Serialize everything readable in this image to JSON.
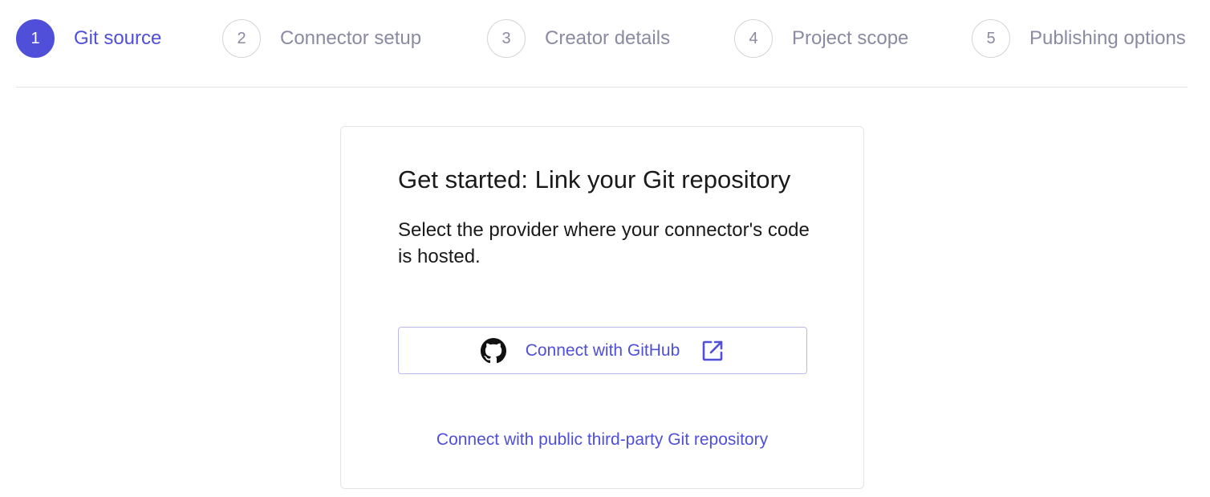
{
  "stepper": {
    "steps": [
      {
        "number": "1",
        "label": "Git source",
        "state": "active"
      },
      {
        "number": "2",
        "label": "Connector setup",
        "state": "inactive"
      },
      {
        "number": "3",
        "label": "Creator details",
        "state": "inactive"
      },
      {
        "number": "4",
        "label": "Project scope",
        "state": "inactive"
      },
      {
        "number": "5",
        "label": "Publishing options",
        "state": "inactive"
      }
    ]
  },
  "card": {
    "title": "Get started: Link your Git repository",
    "description": "Select the provider where your connector's code is hosted.",
    "github_button": {
      "label": "Connect with GitHub",
      "icon": "github-icon",
      "trailing_icon": "external-link-icon"
    },
    "third_party_link": "Connect with public third-party Git repository"
  },
  "colors": {
    "accent": "#4f4fd9",
    "muted_text": "#8a8aa3",
    "border": "#e4e4e7",
    "button_border": "#b9b9ee",
    "body_text": "#1a1a1a"
  }
}
